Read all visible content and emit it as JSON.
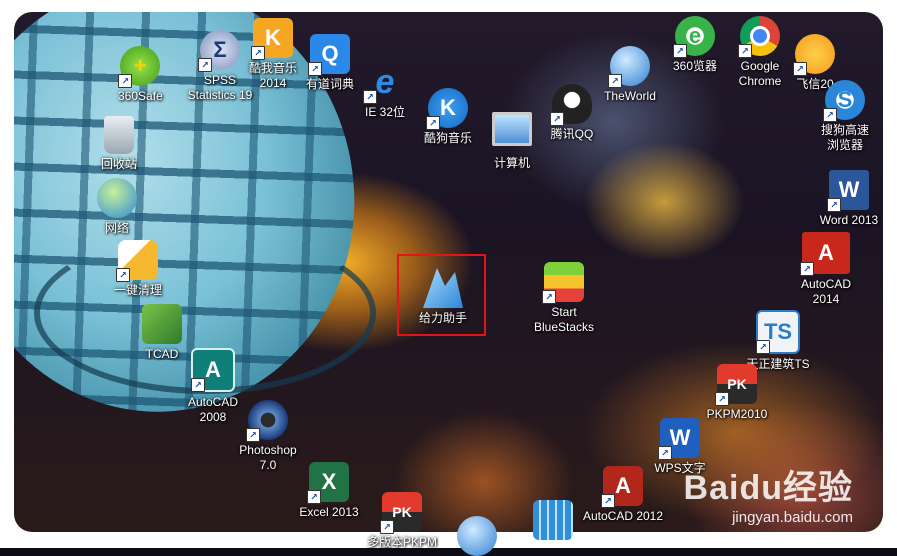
{
  "icons": {
    "safe360": {
      "label": "360Safe"
    },
    "spss": {
      "label": "SPSS Statistics 19"
    },
    "kugou2014": {
      "label": "酷我音乐 2014"
    },
    "youdao": {
      "label": "有道词典"
    },
    "ie32": {
      "label": "IE 32位"
    },
    "kugou": {
      "label": "酷狗音乐"
    },
    "computer": {
      "label": "计算机"
    },
    "qq": {
      "label": "腾讯QQ"
    },
    "theworld": {
      "label": "TheWorld"
    },
    "browser360": {
      "label": "360览器"
    },
    "chrome": {
      "label": "Google Chrome"
    },
    "feixin": {
      "label": "飞信20"
    },
    "sogou": {
      "label": "搜狗高速浏览器"
    },
    "recycle": {
      "label": "回收站"
    },
    "network": {
      "label": "网络"
    },
    "word2013": {
      "label": "Word 2013"
    },
    "cleanup": {
      "label": "一键清理"
    },
    "gelizhu": {
      "label": "给力助手"
    },
    "bluestacks": {
      "label": "Start BlueStacks"
    },
    "autocad2014": {
      "label": "AutoCAD 2014"
    },
    "tcad": {
      "label": "TCAD"
    },
    "tianzheng": {
      "label": "天正建筑TS"
    },
    "autocad2008": {
      "label": "AutoCAD 2008"
    },
    "pkpm2010": {
      "label": "PKPM2010"
    },
    "photoshop": {
      "label": "Photoshop 7.0"
    },
    "wps": {
      "label": "WPS文字"
    },
    "excel2013": {
      "label": "Excel 2013"
    },
    "autocad2012": {
      "label": "AutoCAD 2012"
    },
    "pkpm_new": {
      "label": "多版本PKPM"
    }
  },
  "watermark": {
    "brand": "Baidu经验",
    "url": "jingyan.baidu.com"
  }
}
